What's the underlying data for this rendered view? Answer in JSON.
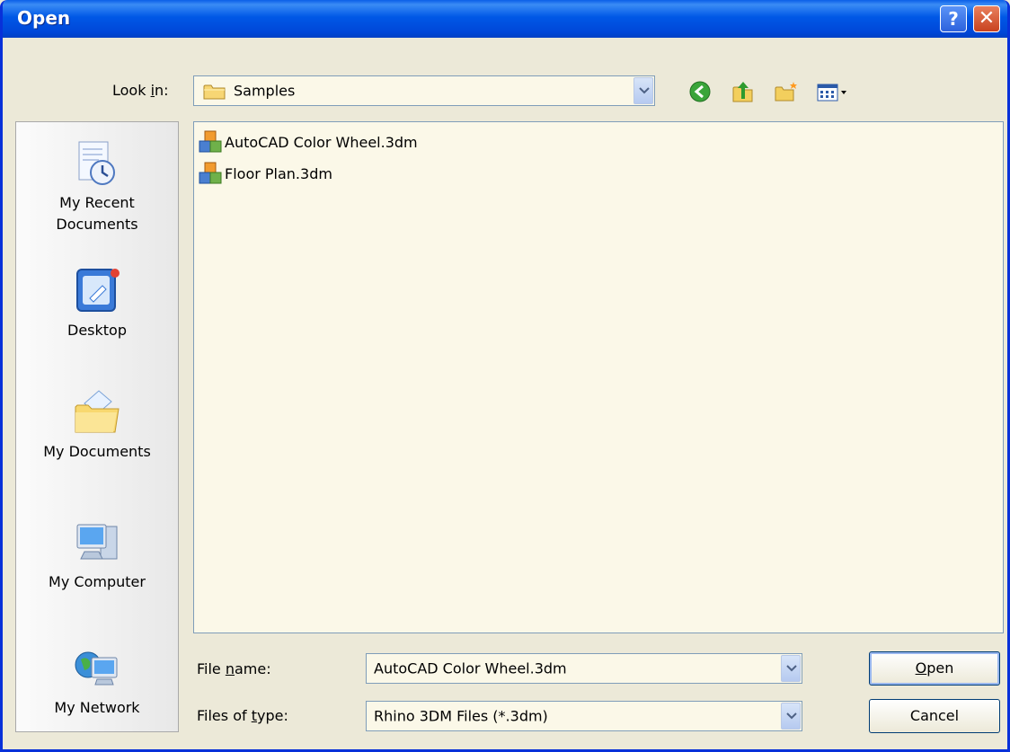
{
  "window": {
    "title": "Open"
  },
  "title_buttons": {
    "help": "?",
    "close": "✕"
  },
  "look_in": {
    "label_prefix": "Look ",
    "label_key": "i",
    "label_suffix": "n:",
    "value": "Samples"
  },
  "toolbar": {
    "back_icon": "back-arrow-icon",
    "up_icon": "up-folder-icon",
    "new_folder_icon": "new-folder-icon",
    "views_icon": "views-menu-icon"
  },
  "places": [
    {
      "label_line1": "My Recent",
      "label_line2": "Documents",
      "icon": "recent-documents-icon"
    },
    {
      "label_line1": "Desktop",
      "label_line2": "",
      "icon": "desktop-icon"
    },
    {
      "label_line1": "My Documents",
      "label_line2": "",
      "icon": "my-documents-icon"
    },
    {
      "label_line1": "My Computer",
      "label_line2": "",
      "icon": "my-computer-icon"
    },
    {
      "label_line1": "My Network",
      "label_line2": "",
      "icon": "my-network-icon"
    }
  ],
  "files": [
    {
      "name": "AutoCAD Color Wheel.3dm"
    },
    {
      "name": "Floor Plan.3dm"
    }
  ],
  "file_name": {
    "label_prefix": "File ",
    "label_key": "n",
    "label_suffix": "ame:",
    "value": "AutoCAD Color Wheel.3dm"
  },
  "file_type": {
    "label_prefix": "Files of ",
    "label_key": "t",
    "label_suffix": "ype:",
    "value": "Rhino 3DM Files (*.3dm)"
  },
  "buttons": {
    "open_key": "O",
    "open_rest": "pen",
    "cancel": "Cancel"
  },
  "colors": {
    "title_blue": "#0058e6",
    "dialog_bg": "#ece9d8",
    "list_bg": "#fbf8e8",
    "close_red": "#c8421f"
  }
}
